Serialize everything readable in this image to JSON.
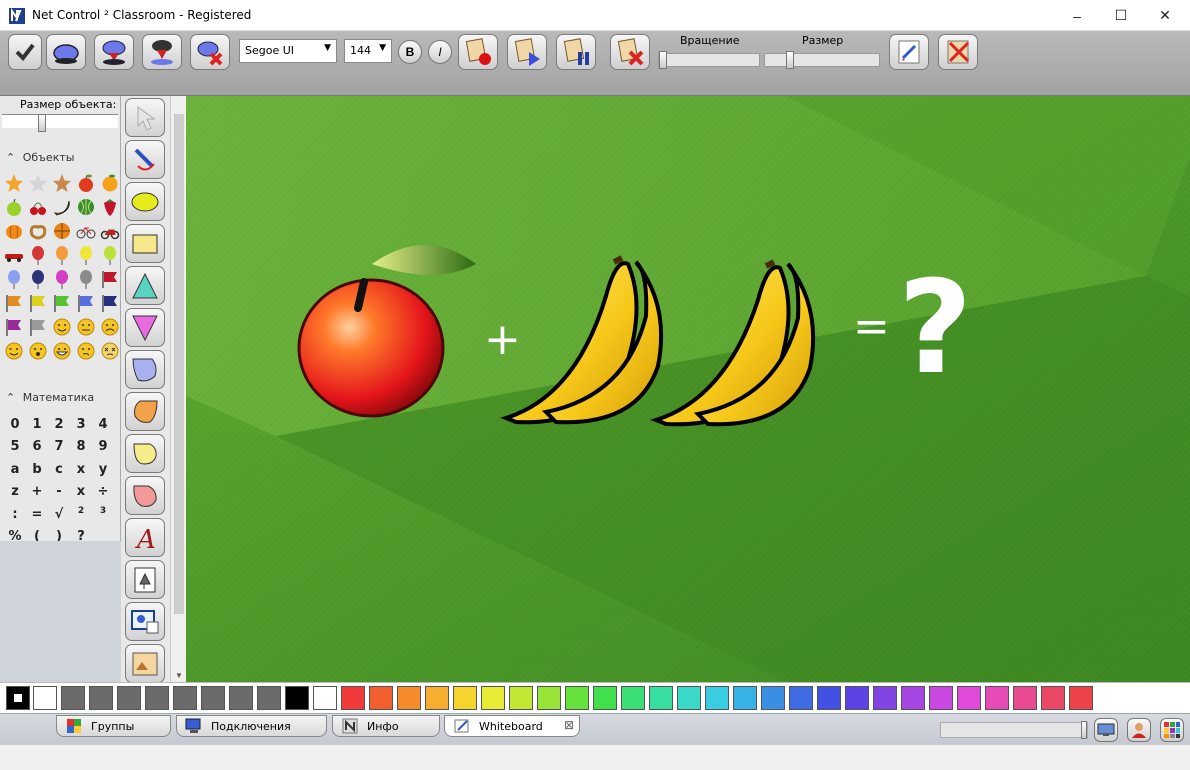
{
  "window": {
    "title": "Net Control ² Classroom - Registered",
    "controls": [
      "minimize-icon",
      "maximize-icon",
      "close-icon"
    ]
  },
  "toolbar": {
    "font_name": "Segoe UI",
    "font_size": "144",
    "bold_label": "B",
    "italic_label": "I",
    "rotation_label": "Вращение",
    "size_label": "Размер",
    "rotation_value": 0,
    "size_value": 0.2
  },
  "left_panel": {
    "object_size_label": "Размер объекта:",
    "object_size_value": 0.33,
    "objects_heading": "Объекты",
    "math_heading": "Математика",
    "math_keys": [
      "0",
      "1",
      "2",
      "3",
      "4",
      "5",
      "6",
      "7",
      "8",
      "9",
      "a",
      "b",
      "c",
      "x",
      "y",
      "z",
      "+",
      "-",
      "x",
      "÷",
      ":",
      "=",
      "√",
      "2",
      "3",
      "%",
      "(",
      ")",
      "?"
    ]
  },
  "canvas": {
    "plus_sign": "+",
    "equals_sign": "=",
    "question_mark": "?"
  },
  "palette": {
    "colors": [
      "#ffffff",
      "#6b6b6b",
      "#6b6b6b",
      "#6b6b6b",
      "#6b6b6b",
      "#6b6b6b",
      "#6b6b6b",
      "#6b6b6b",
      "#6b6b6b",
      "#000000",
      "#ffffff",
      "#f23a3a",
      "#f25e2e",
      "#f68b2c",
      "#f7ae2f",
      "#f5d42c",
      "#e7ec35",
      "#c2e833",
      "#98e437",
      "#66e03b",
      "#40e04d",
      "#39df74",
      "#37dea0",
      "#3ad8c7",
      "#38cde3",
      "#36b2e6",
      "#3a8fe5",
      "#3f6be4",
      "#4350e4",
      "#5c43e5",
      "#8344e5",
      "#a846e4",
      "#c947e2",
      "#e04ad9",
      "#e64ab7",
      "#e94a91",
      "#eb4868",
      "#ee4348"
    ]
  },
  "tabs": [
    {
      "label": "Группы",
      "icon": "groups-icon"
    },
    {
      "label": "Подключения",
      "icon": "connections-icon"
    },
    {
      "label": "Инфо",
      "icon": "info-icon"
    },
    {
      "label": "Whiteboard",
      "icon": "whiteboard-icon",
      "active": true
    }
  ],
  "tab_close": "⊠"
}
